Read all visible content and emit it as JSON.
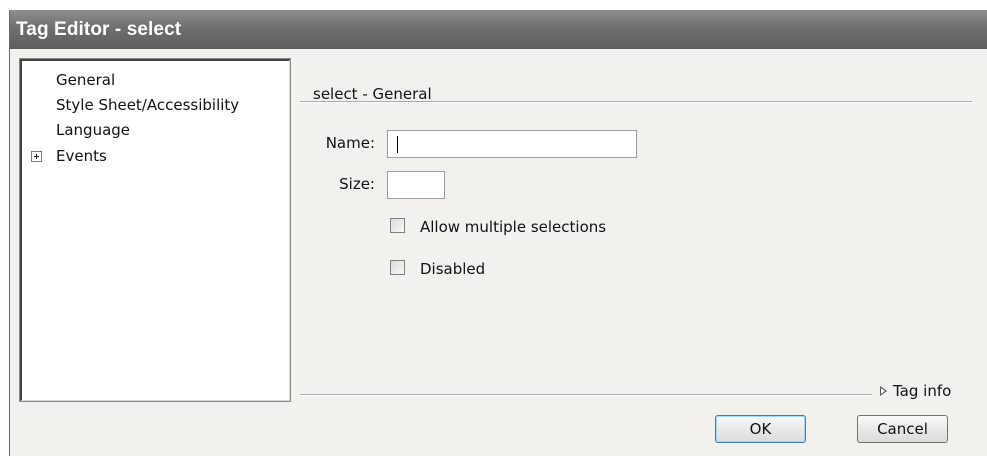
{
  "window": {
    "title": "Tag Editor - select"
  },
  "categories": [
    {
      "label": "General"
    },
    {
      "label": "Style Sheet/Accessibility"
    },
    {
      "label": "Language"
    },
    {
      "label": "Events",
      "expandable": true
    }
  ],
  "panel": {
    "heading": "select - General",
    "name_label": "Name:",
    "name_value": "",
    "size_label": "Size:",
    "size_value": "",
    "checkboxes": [
      {
        "label": "Allow multiple selections",
        "checked": false
      },
      {
        "label": "Disabled",
        "checked": false
      }
    ],
    "tag_info_label": "Tag info"
  },
  "buttons": {
    "ok": "OK",
    "cancel": "Cancel"
  },
  "icons": {
    "expander": "plus-expander-icon",
    "tag_info": "triangle-right-icon"
  }
}
